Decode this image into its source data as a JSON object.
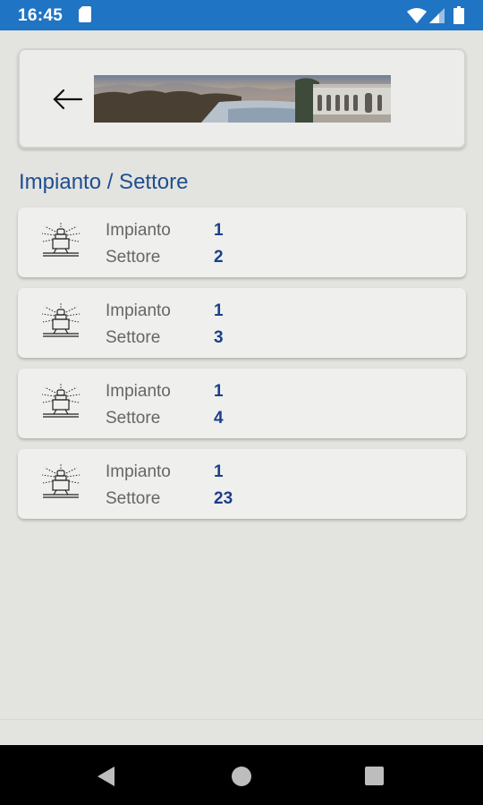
{
  "status_bar": {
    "time": "16:45",
    "icons": [
      "sd-card-icon",
      "wifi-icon",
      "cell-signal-icon",
      "battery-icon"
    ]
  },
  "header": {
    "back_icon": "arrow-left-icon",
    "banner": "landscape-banner-image"
  },
  "section_title": "Impianto / Settore",
  "items": [
    {
      "impianto_label": "Impianto",
      "impianto_value": "1",
      "settore_label": "Settore",
      "settore_value": "2"
    },
    {
      "impianto_label": "Impianto",
      "impianto_value": "1",
      "settore_label": "Settore",
      "settore_value": "3"
    },
    {
      "impianto_label": "Impianto",
      "impianto_value": "1",
      "settore_label": "Settore",
      "settore_value": "4"
    },
    {
      "impianto_label": "Impianto",
      "impianto_value": "1",
      "settore_label": "Settore",
      "settore_value": "23"
    }
  ],
  "nav_bar": {
    "icons": [
      "nav-back-icon",
      "nav-home-icon",
      "nav-recents-icon"
    ]
  },
  "colors": {
    "status_bar": "#1f74c4",
    "background": "#e3e3df",
    "card": "#efefed",
    "title": "#1d4f91",
    "value": "#1a3f8c",
    "label": "#666666"
  }
}
